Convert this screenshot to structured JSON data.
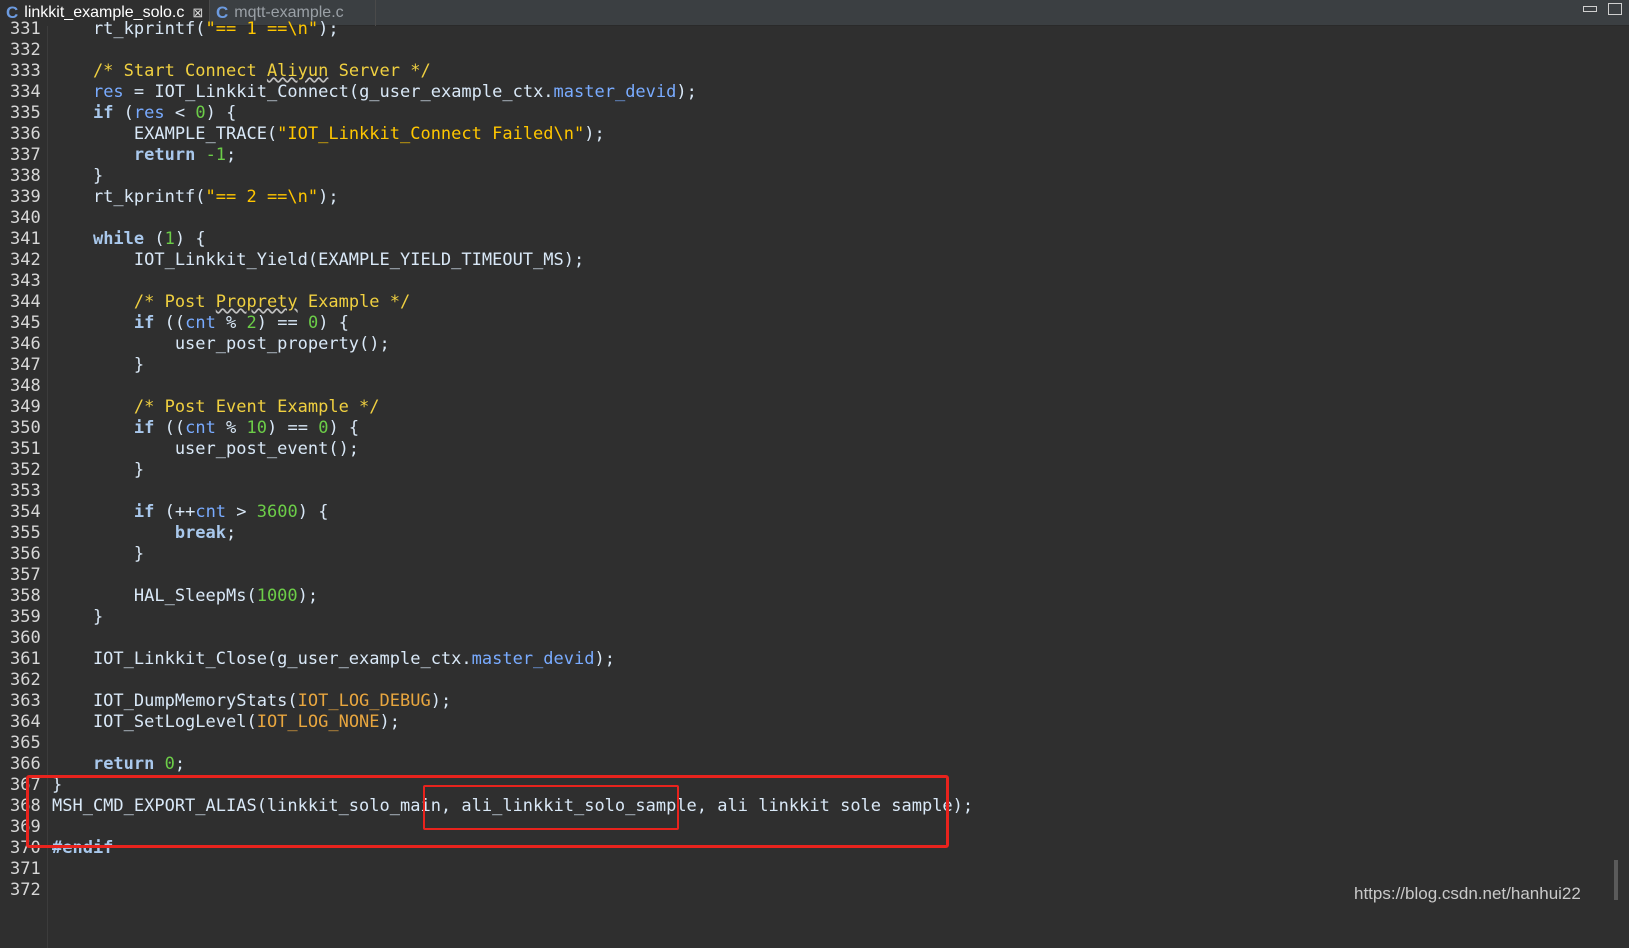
{
  "tabs": [
    {
      "label": "linkkit_example_solo.c",
      "active": true
    },
    {
      "label": "mqtt-example.c",
      "active": false
    }
  ],
  "lines": {
    "l331": {
      "num": "331",
      "a": "    rt_kprintf(",
      "b": "\"== 1 ==\\n\"",
      "c": ");"
    },
    "l332": {
      "num": "332"
    },
    "l333": {
      "num": "333",
      "a": "    /* Start Connect ",
      "u": "Aliyun",
      "b": " Server */"
    },
    "l334": {
      "num": "334",
      "v": "res",
      "a": " = IOT_Linkkit_Connect(g_user_example_ctx.",
      "v2": "master_devid",
      "b": ");"
    },
    "l335": {
      "num": "335",
      "k": "if",
      "a": " (",
      "v": "res",
      "b": " < ",
      "n": "0",
      "c": ") {"
    },
    "l336": {
      "num": "336",
      "a": "        EXAMPLE_TRACE(",
      "s": "\"IOT_Linkkit_Connect Failed\\n\"",
      "b": ");"
    },
    "l337": {
      "num": "337",
      "k": "return",
      "a": " ",
      "n": "-1",
      "b": ";"
    },
    "l338": {
      "num": "338",
      "a": "    }"
    },
    "l339": {
      "num": "339",
      "a": "    rt_kprintf(",
      "s": "\"== 2 ==\\n\"",
      "b": ");"
    },
    "l340": {
      "num": "340"
    },
    "l341": {
      "num": "341",
      "k": "while",
      "a": " (",
      "n": "1",
      "b": ") {"
    },
    "l342": {
      "num": "342",
      "a": "        IOT_Linkkit_Yield(EXAMPLE_YIELD_TIMEOUT_MS);"
    },
    "l343": {
      "num": "343"
    },
    "l344": {
      "num": "344",
      "a": "        /* Post ",
      "u": "Proprety",
      "b": " Example */"
    },
    "l345": {
      "num": "345",
      "k": "if",
      "a": " ((",
      "v": "cnt",
      "b": " % ",
      "n": "2",
      "c": ") == ",
      "n2": "0",
      "d": ") {"
    },
    "l346": {
      "num": "346",
      "a": "            user_post_property();"
    },
    "l347": {
      "num": "347",
      "a": "        }"
    },
    "l348": {
      "num": "348"
    },
    "l349": {
      "num": "349",
      "a": "        /* Post Event Example */"
    },
    "l350": {
      "num": "350",
      "k": "if",
      "a": " ((",
      "v": "cnt",
      "b": " % ",
      "n": "10",
      "c": ") == ",
      "n2": "0",
      "d": ") {"
    },
    "l351": {
      "num": "351",
      "a": "            user_post_event();"
    },
    "l352": {
      "num": "352",
      "a": "        }"
    },
    "l353": {
      "num": "353"
    },
    "l354": {
      "num": "354",
      "k": "if",
      "a": " (++",
      "v": "cnt",
      "b": " > ",
      "n": "3600",
      "c": ") {"
    },
    "l355": {
      "num": "355",
      "k": "break",
      "a": ";"
    },
    "l356": {
      "num": "356",
      "a": "        }"
    },
    "l357": {
      "num": "357"
    },
    "l358": {
      "num": "358",
      "a": "        HAL_SleepMs(",
      "n": "1000",
      "b": ");"
    },
    "l359": {
      "num": "359",
      "a": "    }"
    },
    "l360": {
      "num": "360"
    },
    "l361": {
      "num": "361",
      "a": "    IOT_Linkkit_Close(g_user_example_ctx.",
      "v": "master_devid",
      "b": ");"
    },
    "l362": {
      "num": "362"
    },
    "l363": {
      "num": "363",
      "a": "    IOT_DumpMemoryStats(",
      "m": "IOT_LOG_DEBUG",
      "b": ");"
    },
    "l364": {
      "num": "364",
      "a": "    IOT_SetLogLevel(",
      "m": "IOT_LOG_NONE",
      "b": ");"
    },
    "l365": {
      "num": "365"
    },
    "l366": {
      "num": "366",
      "k": "return",
      "a": " ",
      "n": "0",
      "b": ";"
    },
    "l367": {
      "num": "367",
      "a": "}"
    },
    "l368": {
      "num": "368",
      "a": "MSH_CMD_EXPORT_ALIAS(linkkit_solo_main, ali_linkkit_solo_sample, ali linkkit sole sample);"
    },
    "l369": {
      "num": "369"
    },
    "l370": {
      "num": "370",
      "p": "#endif"
    },
    "l371": {
      "num": "371"
    },
    "l372": {
      "num": "372"
    }
  },
  "watermark": "https://blog.csdn.net/hanhui22",
  "colors": {
    "highlight": "#e8231d",
    "comment": "#f0d040",
    "number": "#6ccd48",
    "string": "#ffc600"
  }
}
